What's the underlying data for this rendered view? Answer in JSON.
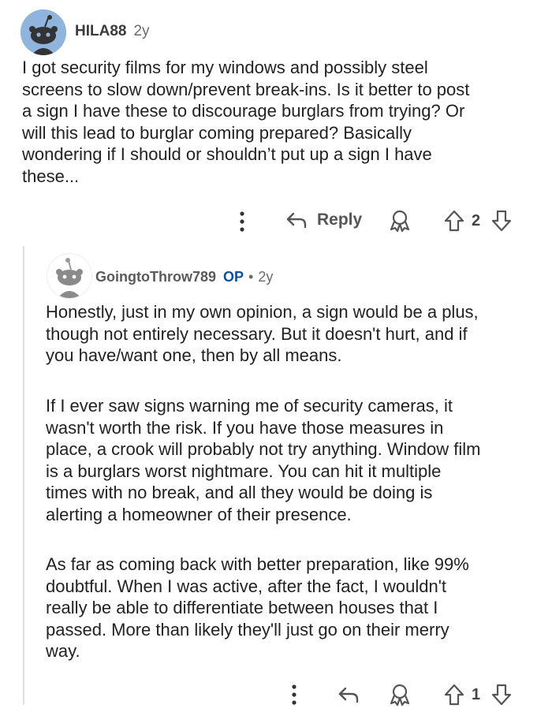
{
  "comment": {
    "username": "HILA88",
    "age": "2y",
    "body": "I got security films for my windows and possibly steel\nscreens to slow down/prevent break-ins. Is it better to post\na sign I have these to discourage burglars from trying? Or\nwill this lead to burglar coming prepared? Basically\nwondering if I should or shouldn’t put up a sign I have\nthese...",
    "actions": {
      "reply_label": "Reply",
      "vote_count": "2"
    }
  },
  "reply": {
    "username": "GoingtoThrow789",
    "op_badge": "OP",
    "separator": "•",
    "age": "2y",
    "paragraphs": [
      "Honestly, just in my own opinion, a sign would be a plus,\nthough not entirely necessary. But it doesn't hurt, and if\nyou have/want one, then by all means.",
      "If I ever saw signs warning me of security cameras, it\nwasn't worth the risk. If you have those measures in\nplace, a crook will probably not try anything. Window film\nis a burglars worst nightmare. You can hit it multiple\ntimes with no break, and all they would be doing is\nalerting a homeowner of their presence.",
      "As far as coming back with better preparation, like 99%\ndoubtful. When I was active, after the fact, I wouldn't\nreally be able to differentiate between houses that I\npassed. More than likely they'll just go on their merry\nway."
    ],
    "actions": {
      "vote_count": "1"
    }
  },
  "icons": [
    "more-options-icon",
    "reply-arrow-icon",
    "award-icon",
    "upvote-arrow-icon",
    "downvote-arrow-icon"
  ],
  "colors": {
    "avatar_background": "#8fb4de",
    "op_badge": "#0a4fa8",
    "thread_line": "#e0e0e0"
  }
}
